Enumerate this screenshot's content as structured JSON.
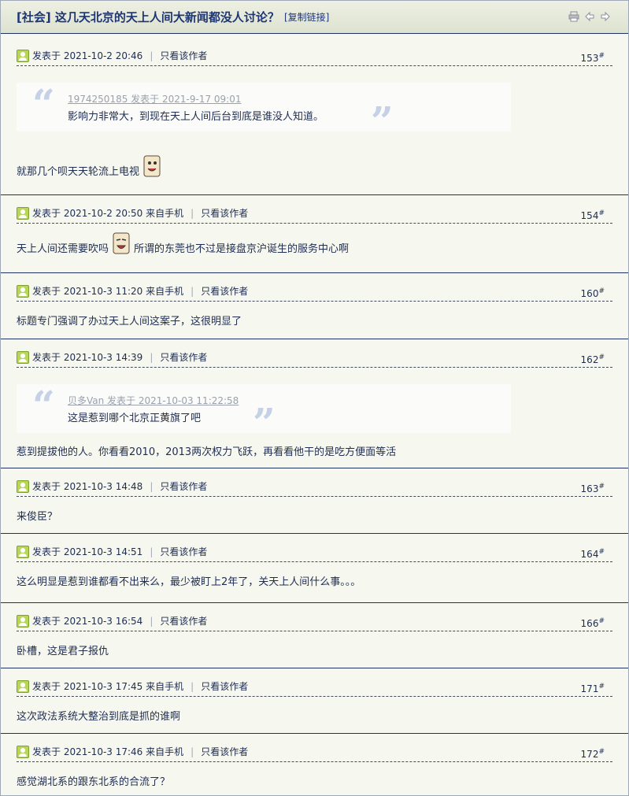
{
  "header": {
    "title": "[社会] 这几天北京的天上人间大新闻都没人讨论？",
    "copy_link": "[复制链接]",
    "tools": [
      "printer-icon",
      "previous-thread-icon",
      "next-thread-icon"
    ]
  },
  "posts": [
    {
      "meta": "发表于 2021-10-2 20:46",
      "only_author": "只看该作者",
      "floor": "153",
      "floor_mark": "#",
      "quote": {
        "source": "1974250185 发表于 2021-9-17 09:01",
        "text": "影响力非常大，到现在天上人间后台到底是谁没人知道。"
      },
      "text": "就那几个呗天天轮流上电视"
    },
    {
      "meta": "发表于 2021-10-2 20:50 来自手机",
      "only_author": "只看该作者",
      "floor": "154",
      "floor_mark": "#",
      "text": "天上人间还需要吹吗",
      "text_after": "所谓的东莞也不过是接盘京沪诞生的服务中心啊"
    },
    {
      "meta": "发表于 2021-10-3 11:20 来自手机",
      "only_author": "只看该作者",
      "floor": "160",
      "floor_mark": "#",
      "text": "标题专门强调了办过天上人间这案子，这很明显了"
    },
    {
      "meta": "发表于 2021-10-3 14:39",
      "only_author": "只看该作者",
      "floor": "162",
      "floor_mark": "#",
      "quote": {
        "source": "贝多Van 发表于 2021-10-03 11:22:58",
        "text": "这是惹到哪个北京正黄旗了吧"
      },
      "text": "惹到提拔他的人。你看看2010，2013两次权力飞跃，再看看他干的是吃方便面等活"
    },
    {
      "meta": "发表于 2021-10-3 14:48",
      "only_author": "只看该作者",
      "floor": "163",
      "floor_mark": "#",
      "text": "来俊臣？"
    },
    {
      "meta": "发表于 2021-10-3 14:51",
      "only_author": "只看该作者",
      "floor": "164",
      "floor_mark": "#",
      "text": "这么明显是惹到谁都看不出来么，最少被盯上2年了，关天上人间什么事。。。"
    },
    {
      "meta": "发表于 2021-10-3 16:54",
      "only_author": "只看该作者",
      "floor": "166",
      "floor_mark": "#",
      "text": "卧槽，这是君子报仇"
    },
    {
      "meta": "发表于 2021-10-3 17:45 来自手机",
      "only_author": "只看该作者",
      "floor": "171",
      "floor_mark": "#",
      "text": "这次政法系统大整治到底是抓的谁啊"
    },
    {
      "meta": "发表于 2021-10-3 17:46 来自手机",
      "only_author": "只看该作者",
      "floor": "172",
      "floor_mark": "#",
      "text": "感觉湖北系的跟东北系的合流了？"
    }
  ]
}
